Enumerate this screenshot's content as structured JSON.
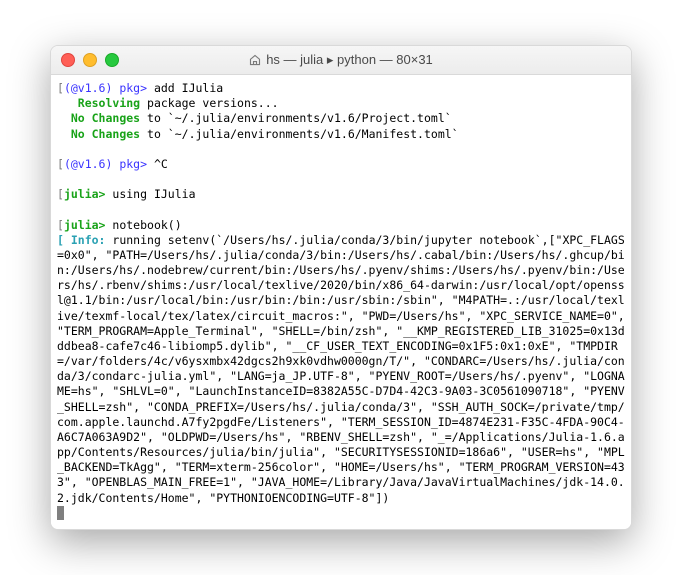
{
  "window": {
    "title": "hs — julia ▸ python — 80×31"
  },
  "terminal": {
    "pkg_prompt": "(@v1.6) pkg>",
    "julia_prompt": "julia>",
    "cmd_add": " add IJulia",
    "resolving_label": "Resolving",
    "resolving_rest": " package versions...",
    "nochanges_label": "No Changes",
    "nochange1": " to `~/.julia/environments/v1.6/Project.toml`",
    "nochange2": " to `~/.julia/environments/v1.6/Manifest.toml`",
    "ctrl_c": " ^C",
    "cmd_using": " using IJulia",
    "cmd_notebook": " notebook()",
    "info_open": "[ ",
    "info_label": "Info:",
    "info_body": " running setenv(`/Users/hs/.julia/conda/3/bin/jupyter notebook`,[\"XPC_FLAGS=0x0\", \"PATH=/Users/hs/.julia/conda/3/bin:/Users/hs/.cabal/bin:/Users/hs/.ghcup/bin:/Users/hs/.nodebrew/current/bin:/Users/hs/.pyenv/shims:/Users/hs/.pyenv/bin:/Users/hs/.rbenv/shims:/usr/local/texlive/2020/bin/x86_64-darwin:/usr/local/opt/openssl@1.1/bin:/usr/local/bin:/usr/bin:/bin:/usr/sbin:/sbin\", \"M4PATH=.:/usr/local/texlive/texmf-local/tex/latex/circuit_macros:\", \"PWD=/Users/hs\", \"XPC_SERVICE_NAME=0\", \"TERM_PROGRAM=Apple_Terminal\", \"SHELL=/bin/zsh\", \"__KMP_REGISTERED_LIB_31025=0x13dddbea8-cafe7c46-libiomp5.dylib\", \"__CF_USER_TEXT_ENCODING=0x1F5:0x1:0xE\", \"TMPDIR=/var/folders/4c/v6ysxmbx42dgcs2h9xk0vdhw0000gn/T/\", \"CONDARC=/Users/hs/.julia/conda/3/condarc-julia.yml\", \"LANG=ja_JP.UTF-8\", \"PYENV_ROOT=/Users/hs/.pyenv\", \"LOGNAME=hs\", \"SHLVL=0\", \"LaunchInstanceID=8382A55C-D7D4-42C3-9A03-3C0561090718\", \"PYENV_SHELL=zsh\", \"CONDA_PREFIX=/Users/hs/.julia/conda/3\", \"SSH_AUTH_SOCK=/private/tmp/com.apple.launchd.A7fy2pgdFe/Listeners\", \"TERM_SESSION_ID=4874E231-F35C-4FDA-90C4-A6C7A063A9D2\", \"OLDPWD=/Users/hs\", \"RBENV_SHELL=zsh\", \"_=/Applications/Julia-1.6.app/Contents/Resources/julia/bin/julia\", \"SECURITYSESSIONID=186a6\", \"USER=hs\", \"MPL_BACKEND=TkAgg\", \"TERM=xterm-256color\", \"HOME=/Users/hs\", \"TERM_PROGRAM_VERSION=433\", \"OPENBLAS_MAIN_FREE=1\", \"JAVA_HOME=/Library/Java/JavaVirtualMachines/jdk-14.0.2.jdk/Contents/Home\", \"PYTHONIOENCODING=UTF-8\"])"
  },
  "bracket_left": "[",
  "bracket_right": "]"
}
